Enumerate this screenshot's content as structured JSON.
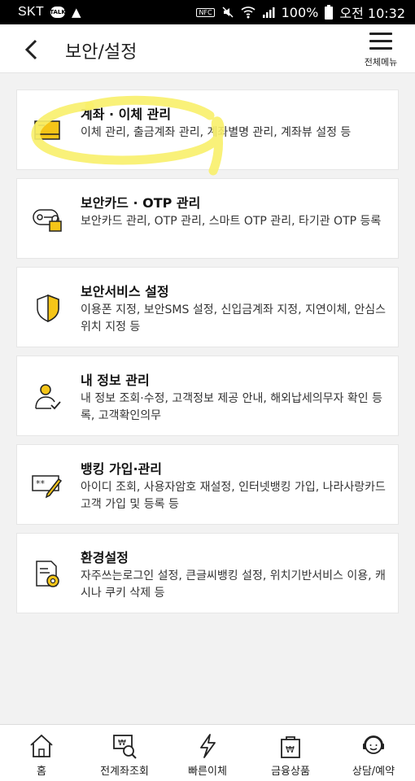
{
  "status_bar": {
    "carrier": "SKT",
    "talk_badge": "TALK",
    "nfc": "NFC",
    "battery": "100%",
    "time": "오전 10:32"
  },
  "header": {
    "title": "보안/설정",
    "menu_label": "전체메뉴"
  },
  "cards": [
    {
      "title": "계좌 · 이체 관리",
      "desc": "이체 관리, 출금계좌 관리, 계좌별명 관리, 계좌뷰 설정 등",
      "icon": "account-card-icon"
    },
    {
      "title": "보안카드 · OTP 관리",
      "desc": "보안카드 관리, OTP 관리, 스마트 OTP 관리, 타기관 OTP 등록",
      "icon": "otp-lock-icon"
    },
    {
      "title": "보안서비스 설정",
      "desc": "이용폰 지정, 보안SMS 설정, 신입금계좌 지정, 지연이체, 안심스위치 지정 등",
      "icon": "shield-icon"
    },
    {
      "title": "내 정보 관리",
      "desc": "내 정보 조회·수정, 고객정보 제공 안내, 해외납세의무자 확인 등록, 고객확인의무",
      "icon": "user-check-icon"
    },
    {
      "title": "뱅킹 가입·관리",
      "desc": "아이디 조회, 사용자암호 재설정, 인터넷뱅킹 가입, 나라사랑카드고객 가입 및 등록 등",
      "icon": "password-pen-icon"
    },
    {
      "title": "환경설정",
      "desc": "자주쓰는로그인 설정, 큰글씨뱅킹 설정, 위치기반서비스 이용, 캐시나 쿠키 삭제 등",
      "icon": "document-gear-icon"
    }
  ],
  "bottom_nav": [
    {
      "label": "홈",
      "icon": "home-icon"
    },
    {
      "label": "전계좌조회",
      "icon": "account-search-icon"
    },
    {
      "label": "빠른이체",
      "icon": "lightning-icon"
    },
    {
      "label": "금융상품",
      "icon": "bag-icon"
    },
    {
      "label": "상담/예약",
      "icon": "consult-icon"
    }
  ],
  "colors": {
    "accent_yellow": "#f5c518",
    "highlight_yellow": "#f8ef6a",
    "background": "#f2f2f2"
  }
}
